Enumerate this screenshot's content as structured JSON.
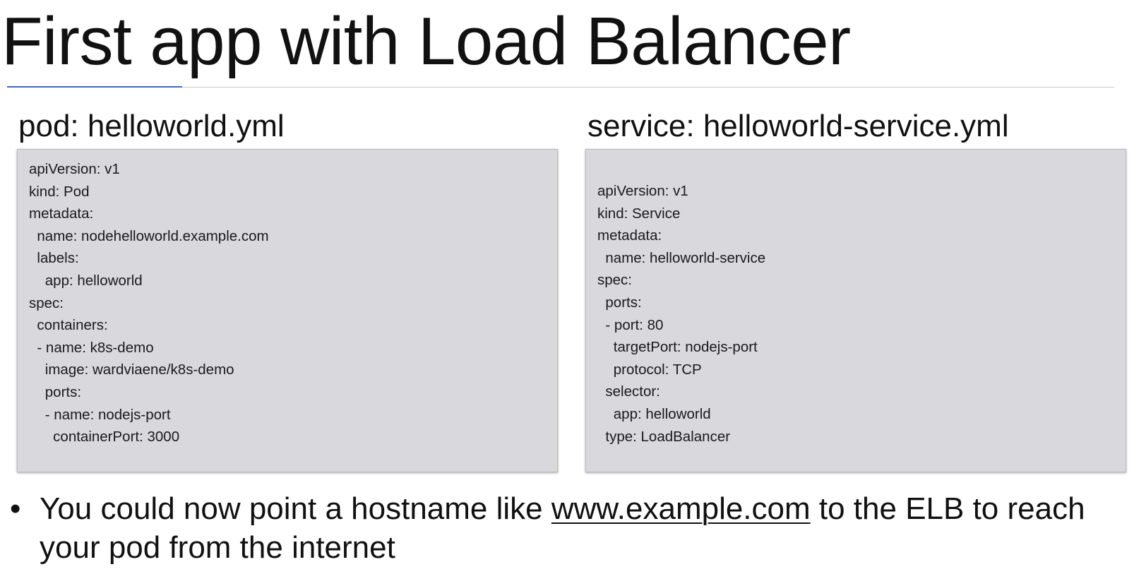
{
  "title": "First app with Load Balancer",
  "pod": {
    "heading": "pod: helloworld.yml",
    "lines": [
      "apiVersion: v1",
      "kind: Pod",
      "metadata:",
      "  name: nodehelloworld.example.com",
      "  labels:",
      "    app: helloworld",
      "spec:",
      "  containers:",
      "  - name: k8s-demo",
      "    image: wardviaene/k8s-demo",
      "    ports:",
      "    - name: nodejs-port",
      "      containerPort: 3000"
    ]
  },
  "service": {
    "heading": "service: helloworld-service.yml",
    "lines": [
      "apiVersion: v1",
      "kind: Service",
      "metadata:",
      "  name: helloworld-service",
      "spec:",
      "  ports:",
      "  - port: 80",
      "    targetPort: nodejs-port",
      "    protocol: TCP",
      "  selector:",
      "    app: helloworld",
      "  type: LoadBalancer"
    ]
  },
  "bullet": {
    "marker": "•",
    "before": "You could now point a hostname like ",
    "link": "www.example.com",
    "after": " to the ELB to reach your pod from the internet"
  },
  "colors": {
    "accent": "#3b67c8",
    "code_background": "#d9d8dd"
  }
}
